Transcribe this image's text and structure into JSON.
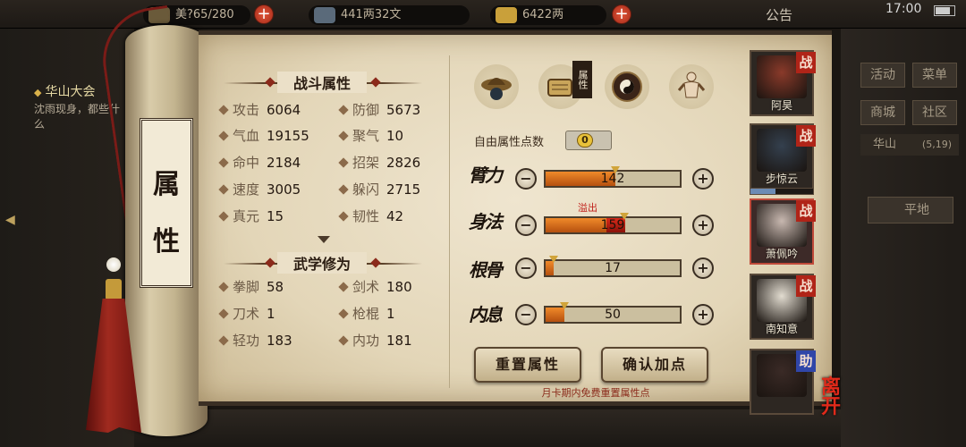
{
  "topbar": {
    "res1": "美?65/280",
    "res2": "441两32文",
    "res3": "6422两",
    "notice": "公告",
    "clock": "17:00"
  },
  "quest": {
    "title": "华山大会",
    "text": "沈雨现身，都些什么"
  },
  "right_panel": {
    "btn1": "活动",
    "btn2": "菜单",
    "btn3": "商城",
    "btn4": "社区",
    "location": "华山",
    "coord": "(5,19)",
    "place": "平地"
  },
  "rod_label": [
    "属",
    "性"
  ],
  "combat": {
    "title": "战斗属性",
    "stats": [
      {
        "label": "攻击",
        "value": "6064"
      },
      {
        "label": "防御",
        "value": "5673"
      },
      {
        "label": "气血",
        "value": "19155"
      },
      {
        "label": "聚气",
        "value": "10"
      },
      {
        "label": "命中",
        "value": "2184"
      },
      {
        "label": "招架",
        "value": "2826"
      },
      {
        "label": "速度",
        "value": "3005"
      },
      {
        "label": "躲闪",
        "value": "2715"
      },
      {
        "label": "真元",
        "value": "15"
      },
      {
        "label": "韧性",
        "value": "42"
      }
    ]
  },
  "martial": {
    "title": "武学修为",
    "stats": [
      {
        "label": "拳脚",
        "value": "58"
      },
      {
        "label": "剑术",
        "value": "180"
      },
      {
        "label": "刀术",
        "value": "1"
      },
      {
        "label": "枪棍",
        "value": "1"
      },
      {
        "label": "轻功",
        "value": "183"
      },
      {
        "label": "内功",
        "value": "181"
      }
    ]
  },
  "tabs": {
    "icons": [
      "hat-icon",
      "scroll-icon",
      "bagua-icon",
      "body-icon"
    ],
    "active_tag": "属性"
  },
  "free_points": {
    "label": "自由属性点数",
    "value": "0"
  },
  "attributes": [
    {
      "name": "臂力",
      "value": "142",
      "fill": 0.52
    },
    {
      "name": "身法",
      "value": "159",
      "fill": 0.45,
      "over": 0.14,
      "overflow_label": "溢出"
    },
    {
      "name": "根骨",
      "value": "17",
      "fill": 0.06
    },
    {
      "name": "内息",
      "value": "50",
      "fill": 0.14
    }
  ],
  "buttons": {
    "reset": "重置属性",
    "confirm": "确认加点"
  },
  "note": "月卡期内免费重置属性点",
  "party": [
    {
      "name": "阿昊",
      "tag": "战",
      "color": "#8a3a2a"
    },
    {
      "name": "步惊云",
      "tag": "战",
      "color": "#34404e"
    },
    {
      "name": "萧佩吟",
      "tag": "战",
      "color": "#c8b8b0"
    },
    {
      "name": "南知意",
      "tag": "战",
      "color": "#e2dcd0"
    },
    {
      "name": "",
      "tag": "助",
      "color": "#3a2a26"
    }
  ],
  "leave": "离开",
  "colors": {
    "accent_red": "#b02418",
    "bar_orange": "#f08a2a",
    "paper": "#e3d6b8"
  }
}
